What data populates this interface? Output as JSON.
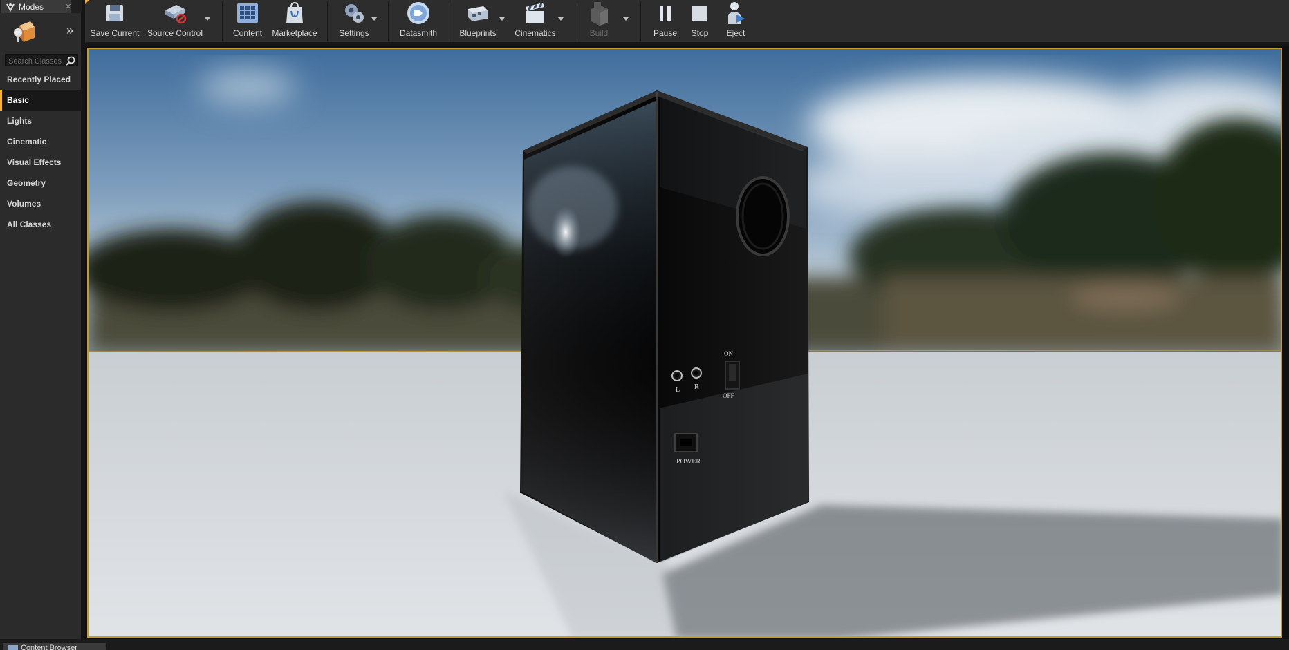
{
  "modes_panel": {
    "tab_title": "Modes",
    "search": {
      "placeholder": "Search Classes",
      "value": ""
    },
    "categories": [
      {
        "label": "Recently Placed",
        "active": false
      },
      {
        "label": "Basic",
        "active": true
      },
      {
        "label": "Lights",
        "active": false
      },
      {
        "label": "Cinematic",
        "active": false
      },
      {
        "label": "Visual Effects",
        "active": false
      },
      {
        "label": "Geometry",
        "active": false
      },
      {
        "label": "Volumes",
        "active": false
      },
      {
        "label": "All Classes",
        "active": false
      }
    ]
  },
  "toolbar": {
    "save_current": "Save Current",
    "source_control": "Source Control",
    "content": "Content",
    "marketplace": "Marketplace",
    "settings": "Settings",
    "datasmith": "Datasmith",
    "blueprints": "Blueprints",
    "cinematics": "Cinematics",
    "build": "Build",
    "pause": "Pause",
    "stop": "Stop",
    "eject": "Eject"
  },
  "viewport": {
    "speaker_labels": {
      "jack_left": "L",
      "jack_right": "R",
      "switch_on": "ON",
      "switch_off": "OFF",
      "power": "POWER"
    }
  },
  "bottom": {
    "content_browser_tab": "Content Browser"
  },
  "colors": {
    "accent": "#f2b233",
    "panel_bg": "#2b2b2b",
    "toolbar_bg": "#2d2d2d"
  }
}
